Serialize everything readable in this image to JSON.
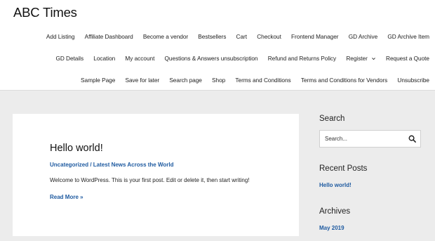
{
  "site": {
    "title": "ABC Times"
  },
  "nav": {
    "row1": [
      "Add Listing",
      "Affiliate Dashboard",
      "Become a vendor",
      "Bestsellers",
      "Cart",
      "Checkout",
      "Frontend Manager",
      "GD Archive",
      "GD Archive Item"
    ],
    "row2": [
      "GD Details",
      "Location",
      "My account",
      "Questions & Answers unsubscription",
      "Refund and Returns Policy",
      "Register",
      "Request a Quote"
    ],
    "row3": [
      "Sample Page",
      "Save for later",
      "Search page",
      "Shop",
      "Terms and Conditions",
      "Terms and Conditions for Vendors",
      "Unsubscribe"
    ]
  },
  "post": {
    "title": "Hello world!",
    "category1": "Uncategorized",
    "separator": " / ",
    "category2": "Latest News Across the World",
    "excerpt": "Welcome to WordPress. This is your first post. Edit or delete it, then start writing!",
    "read_more": "Read More »"
  },
  "sidebar": {
    "search_title": "Search",
    "search_placeholder": "Search...",
    "search_icon": "search-icon",
    "recent_title": "Recent Posts",
    "recent_posts": [
      "Hello world!"
    ],
    "archives_title": "Archives",
    "archives": [
      "May 2019"
    ]
  },
  "colors": {
    "link": "#1e5aa0",
    "background": "#ececec",
    "card": "#ffffff"
  }
}
